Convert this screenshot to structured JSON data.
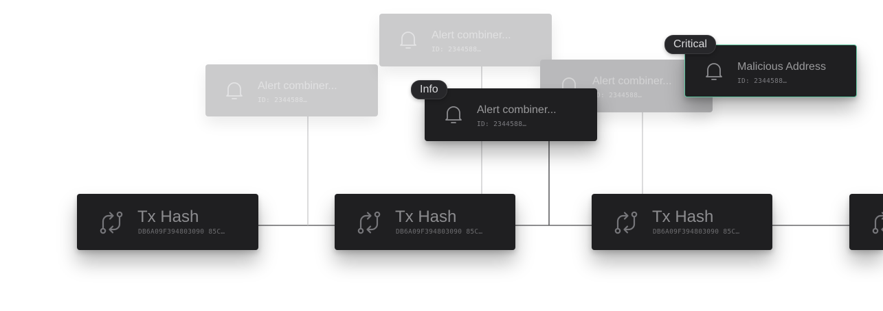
{
  "colors": {
    "card_bg": "#1f1f21",
    "faded_card_bg": "#cbcbcc",
    "edge": "#4a4a4d",
    "accent": "#5fc6a0"
  },
  "tx_nodes": [
    {
      "title": "Tx Hash",
      "hash": "DB6A09F394803090 85C…",
      "icon": "transaction-swap-icon"
    },
    {
      "title": "Tx Hash",
      "hash": "DB6A09F394803090 85C…",
      "icon": "transaction-swap-icon"
    },
    {
      "title": "Tx Hash",
      "hash": "DB6A09F394803090 85C…",
      "icon": "transaction-swap-icon"
    }
  ],
  "alerts": {
    "back_left": {
      "title": "Alert combiner...",
      "id": "ID: 2344588…",
      "icon": "bell-icon"
    },
    "back_top": {
      "title": "Alert combiner...",
      "id": "ID: 2344588…",
      "icon": "bell-icon"
    },
    "back_right": {
      "title": "Alert combiner...",
      "id": "ID: 2344588…",
      "icon": "bell-icon"
    },
    "info": {
      "title": "Alert combiner...",
      "id": "ID: 2344588…",
      "badge": "Info",
      "icon": "bell-icon"
    },
    "critical": {
      "title": "Malicious Address",
      "id": "ID: 2344588…",
      "badge": "Critical",
      "icon": "bell-icon"
    }
  }
}
